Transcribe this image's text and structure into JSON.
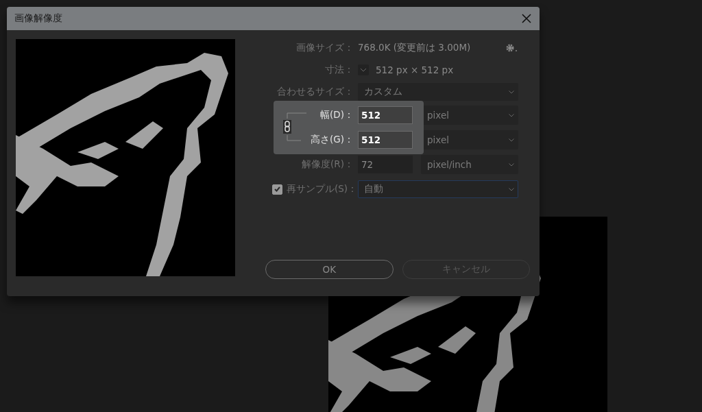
{
  "window": {
    "title": "画像解像度"
  },
  "image_size": {
    "label": "画像サイズ：",
    "value": "768.0K (変更前は 3.00M)"
  },
  "dimensions": {
    "label": "寸法：",
    "value": "512 px × 512 px"
  },
  "fit_to": {
    "label": "合わせるサイズ：",
    "value": "カスタム"
  },
  "width": {
    "label": "幅(D)：",
    "value": "512",
    "unit": "pixel"
  },
  "height": {
    "label": "高さ(G)：",
    "value": "512",
    "unit": "pixel"
  },
  "constrain": {
    "linked": true
  },
  "resolution": {
    "label": "解像度(R)：",
    "value": "72",
    "unit": "pixel/inch"
  },
  "resample": {
    "label": "再サンプル(S)：",
    "checked": true,
    "value": "自動"
  },
  "buttons": [
    {
      "label": "OK",
      "kind": "primary"
    },
    {
      "label": "キャンセル",
      "kind": "secondary"
    }
  ]
}
